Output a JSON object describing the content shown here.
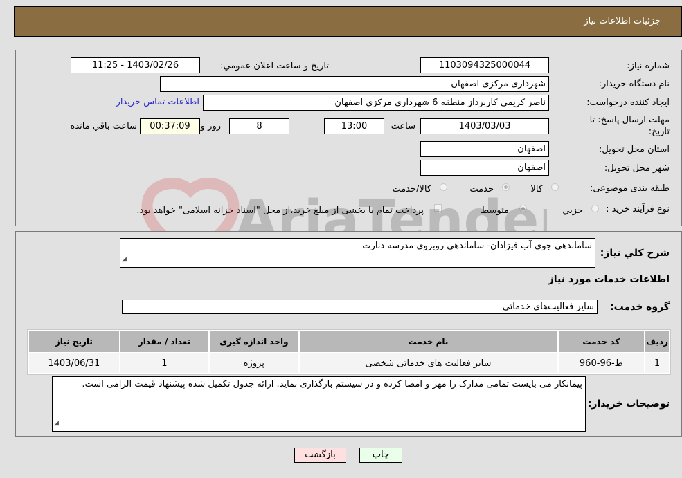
{
  "header": {
    "title": "جزئیات اطلاعات نیاز"
  },
  "info": {
    "need_number_label": "شماره نیاز:",
    "need_number": "1103094325000044",
    "announce_label": "تاريخ و ساعت اعلان عمومي:",
    "announce_value": "1403/02/26 - 11:25",
    "buyer_org_label": "نام دستگاه خريدار:",
    "buyer_org": "شهرداری مرکزی اصفهان",
    "creator_label": "ايجاد کننده درخواست:",
    "creator": "ناصر کریمی کاربرداز منطقه 6 شهرداری مرکزی اصفهان",
    "contact_link": "اطلاعات تماس خريدار",
    "deadline_label_line1": "مهلت ارسال پاسخ: تا",
    "deadline_label_line2": "تاريخ:",
    "deadline_date": "1403/03/03",
    "time_label": "ساعت",
    "deadline_time": "13:00",
    "days_value": "8",
    "days_label": "روز و",
    "remaining_time": "00:37:09",
    "remaining_label": "ساعت باقي مانده",
    "province_label": "استان محل تحويل:",
    "province": "اصفهان",
    "city_label": "شهر محل تحويل:",
    "city": "اصفهان",
    "category_label": "طبقه بندی موضوعی:",
    "category_options": [
      {
        "label": "کالا",
        "checked": false
      },
      {
        "label": "خدمت",
        "checked": true
      },
      {
        "label": "کالا/خدمت",
        "checked": false
      }
    ],
    "process_label": "نوع فرآيند خريد :",
    "process_options": [
      {
        "label": "جزيي",
        "checked": false
      },
      {
        "label": "متوسط",
        "checked": true
      }
    ],
    "payment_note": "پرداخت تمام يا بخشی از مبلغ خريد،از محل \"اسناد خزانه اسلامی\" خواهد بود."
  },
  "details": {
    "description_label": "شرح کلي نياز:",
    "description": "ساماندهی جوی آب فیزادان- ساماندهی روبروی مدرسه دنارت",
    "services_heading": "اطلاعات خدمات مورد نياز",
    "service_group_label": "گروه خدمت:",
    "service_group": "ساير فعاليت‌هاى خدماتى",
    "table": {
      "headers": [
        "رديف",
        "کد خدمت",
        "نام خدمت",
        "واحد اندازه گيری",
        "تعداد / مقدار",
        "تاريخ نياز"
      ],
      "rows": [
        [
          "1",
          "ط-96-960",
          "ساير فعاليت های خدماتی شخصی",
          "پروژه",
          "1",
          "1403/06/31"
        ]
      ]
    },
    "buyer_notes_label": "توضيحات خريدار:",
    "buyer_notes": "پیمانکار می بایست تمامی مدارک را مهر و امضا کرده و در سیستم بارگذاری نماید. ارائه جدول تکمیل شده پیشنهاد قیمت الزامی است."
  },
  "buttons": {
    "print": "چاپ",
    "back": "بازگشت"
  },
  "watermark": {
    "text": "AriaTender.neT"
  },
  "colors": {
    "header_bg": "#8b6d42",
    "back_bg": "#ffe0e0",
    "print_bg": "#eaffea",
    "link": "#2a2acc"
  }
}
